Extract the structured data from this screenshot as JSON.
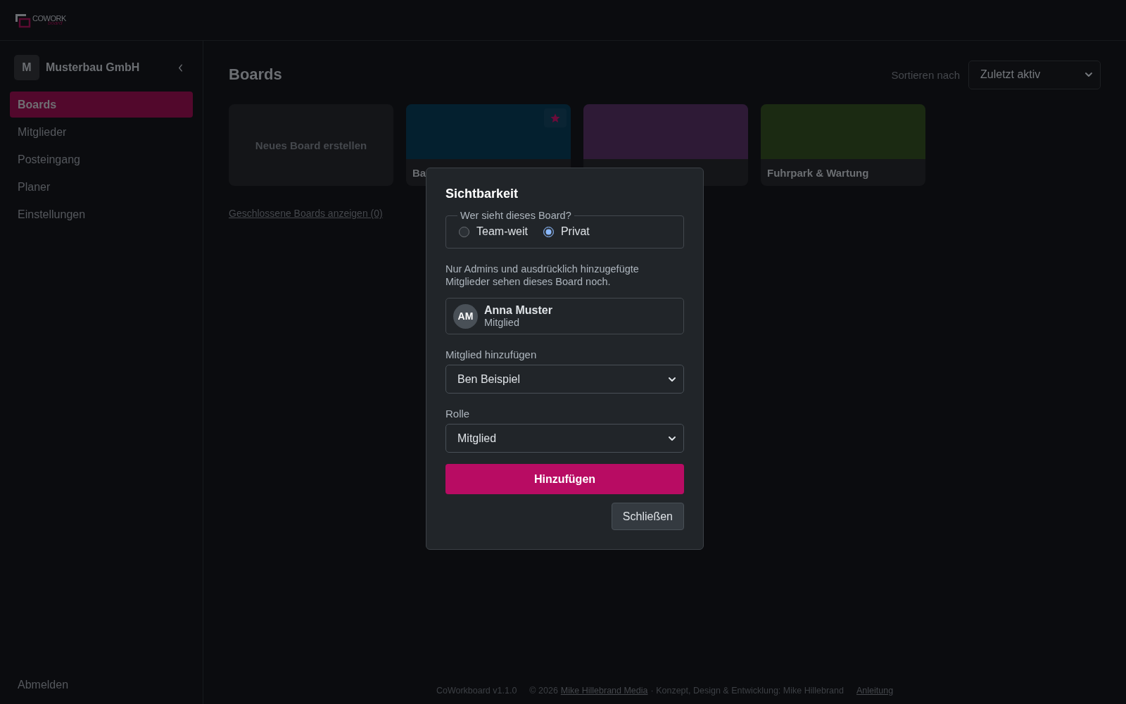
{
  "logo": {
    "name": "COWORK",
    "tagline": "board"
  },
  "sidebar": {
    "workspace": {
      "initial": "M",
      "name": "Musterbau GmbH"
    },
    "items": [
      {
        "label": "Boards",
        "selected": true
      },
      {
        "label": "Mitglieder",
        "selected": false
      },
      {
        "label": "Posteingang",
        "selected": false
      },
      {
        "label": "Planer",
        "selected": false
      },
      {
        "label": "Einstellungen",
        "selected": false
      }
    ],
    "logout": "Abmelden"
  },
  "main": {
    "title": "Boards",
    "sort": {
      "label": "Sortieren nach",
      "value": "Zuletzt aktiv"
    },
    "new_board": "Neues Board erstellen",
    "boards": [
      {
        "title": "Ba",
        "color": "#04202f",
        "starred": true
      },
      {
        "color": "#2e1a36",
        "starred": false
      },
      {
        "title": "Fuhrpark & Wartung",
        "color": "#1b2a12",
        "starred": false
      }
    ],
    "closed_link": "Geschlossene Boards anzeigen (0)"
  },
  "footer": {
    "version": "CoWorkboard v1.1.0",
    "copyright": "© 2026",
    "company_link": "Mike Hillebrand Media",
    "credit": "· Konzept, Design & Entwicklung: Mike Hillebrand",
    "guide_link": "Anleitung"
  },
  "dialog": {
    "title": "Sichtbarkeit",
    "visibility": {
      "legend": "Wer sieht dieses Board?",
      "options": [
        {
          "label": "Team-weit",
          "selected": false
        },
        {
          "label": "Privat",
          "selected": true
        }
      ]
    },
    "note": "Nur Admins und ausdrücklich hinzugefügte Mitglieder sehen dieses Board noch.",
    "members": [
      {
        "initials": "AM",
        "name": "Anna Muster",
        "role": "Mitglied"
      }
    ],
    "add_member": {
      "label": "Mitglied hinzufügen",
      "value": "Ben Beispiel"
    },
    "role": {
      "label": "Rolle",
      "value": "Mitglied"
    },
    "add_button": "Hinzufügen",
    "close_button": "Schließen"
  }
}
